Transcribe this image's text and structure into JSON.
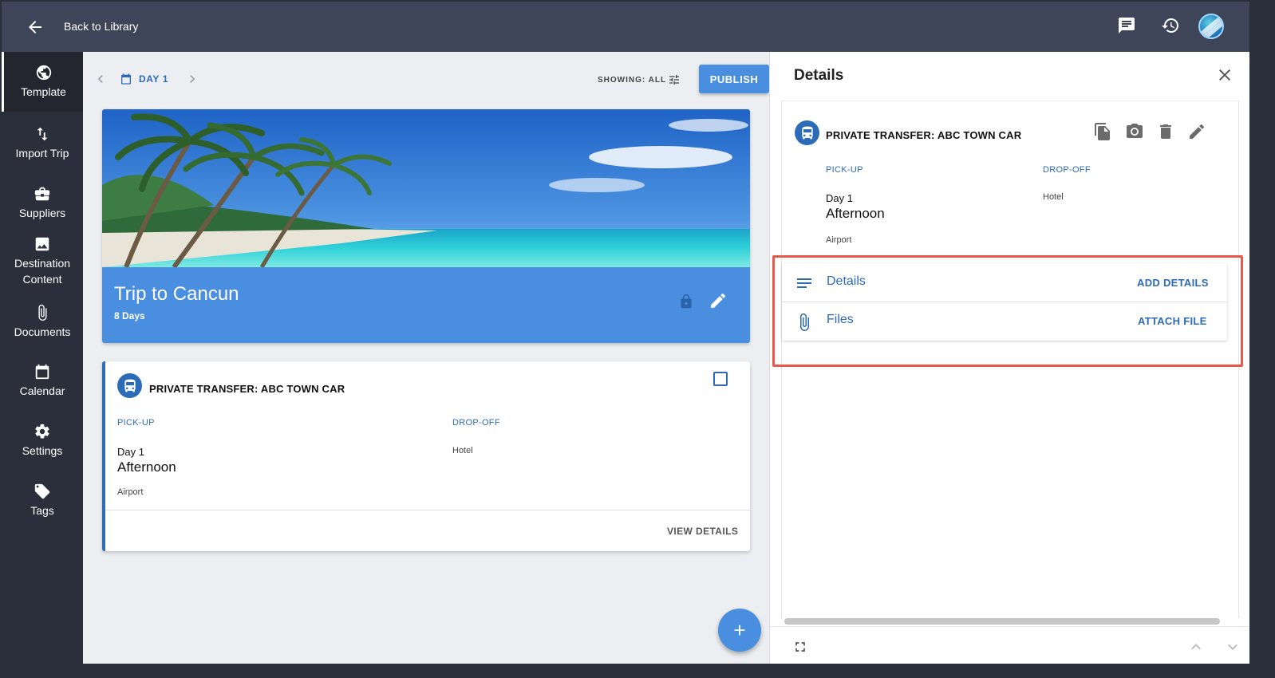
{
  "header": {
    "back_label": "Back to Library",
    "icons": [
      "arrow-left-icon",
      "chat-icon",
      "history-icon",
      "avatar"
    ]
  },
  "sidebar": {
    "items": [
      {
        "label": "Template",
        "icon": "globe-icon",
        "active": true
      },
      {
        "label": "Import Trip",
        "icon": "swap-vertical-icon",
        "active": false
      },
      {
        "label": "Suppliers",
        "icon": "briefcase-icon",
        "active": false
      },
      {
        "label": "Destination Content",
        "icon": "image-icon",
        "active": false
      },
      {
        "label": "Documents",
        "icon": "paperclip-icon",
        "active": false
      },
      {
        "label": "Calendar",
        "icon": "calendar-icon",
        "active": false
      },
      {
        "label": "Settings",
        "icon": "gear-icon",
        "active": false
      },
      {
        "label": "Tags",
        "icon": "tag-icon",
        "active": false
      }
    ]
  },
  "toolbar": {
    "day_label": "DAY 1",
    "showing_label": "SHOWING: ALL",
    "publish_label": "PUBLISH"
  },
  "hero": {
    "title": "Trip to Cancun",
    "days": "8 Days"
  },
  "card": {
    "title": "PRIVATE TRANSFER: ABC TOWN CAR",
    "pickup_label": "PICK-UP",
    "dropoff_label": "DROP-OFF",
    "pickup_day": "Day 1",
    "pickup_time": "Afternoon",
    "pickup_location": "Airport",
    "dropoff_location": "Hotel",
    "view_details_label": "VIEW DETAILS"
  },
  "details_panel": {
    "title": "Details",
    "item_title": "PRIVATE TRANSFER: ABC TOWN CAR",
    "pickup_label": "PICK-UP",
    "dropoff_label": "DROP-OFF",
    "pickup_day": "Day 1",
    "pickup_time": "Afternoon",
    "pickup_location": "Airport",
    "dropoff_location": "Hotel",
    "rows": [
      {
        "label": "Details",
        "action": "ADD DETAILS",
        "icon": "notes-icon"
      },
      {
        "label": "Files",
        "action": "ATTACH FILE",
        "icon": "paperclip-icon"
      }
    ]
  },
  "colors": {
    "accent": "#4a8fdf",
    "brand_blue": "#2c6bb8",
    "topbar": "#3e4558",
    "sidebar": "#2b2e3b",
    "highlight": "#e8594c"
  }
}
